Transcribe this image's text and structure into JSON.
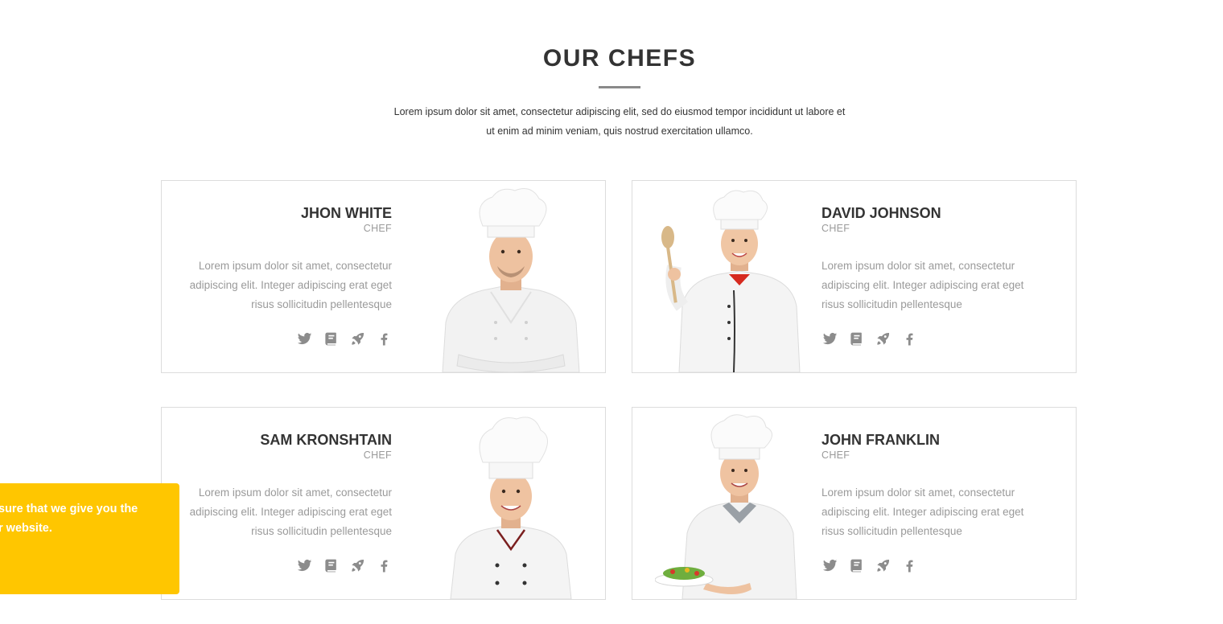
{
  "section": {
    "title": "OUR CHEFS",
    "intro_line1": "Lorem ipsum dolor sit amet, consectetur adipiscing elit, sed do eiusmod tempor incididunt ut labore et",
    "intro_line2": "ut enim ad minim veniam, quis nostrud exercitation ullamco."
  },
  "chefs": [
    {
      "name": "JHON WHITE",
      "role": "CHEF",
      "bio": "Lorem ipsum dolor sit amet, consectetur adipiscing elit. Integer adipiscing erat eget risus sollicitudin pellentesque",
      "image": "male-chef-arms-crossed"
    },
    {
      "name": "DAVID JOHNSON",
      "role": "CHEF",
      "bio": "Lorem ipsum dolor sit amet, consectetur adipiscing elit. Integer adipiscing erat eget risus sollicitudin pellentesque",
      "image": "female-chef-with-spoon"
    },
    {
      "name": "SAM KRONSHTAIN",
      "role": "CHEF",
      "bio": "Lorem ipsum dolor sit amet, consectetur adipiscing elit. Integer adipiscing erat eget risus sollicitudin pellentesque",
      "image": "smiling-male-chef"
    },
    {
      "name": "JOHN FRANKLIN",
      "role": "CHEF",
      "bio": "Lorem ipsum dolor sit amet, consectetur adipiscing elit. Integer adipiscing erat eget risus sollicitudin pellentesque",
      "image": "chef-holding-salad-plate"
    }
  ],
  "social_icons": [
    "twitter-icon",
    "book-icon",
    "rocket-icon",
    "facebook-icon"
  ],
  "cookie_notice": {
    "line1": "sure that we give you the",
    "line2": "r website."
  },
  "colors": {
    "accent_yellow": "#ffc600",
    "heading": "#333333",
    "muted_text": "#9a9a9a",
    "icon": "#8c8c8c",
    "card_border": "#dcdcdc"
  }
}
